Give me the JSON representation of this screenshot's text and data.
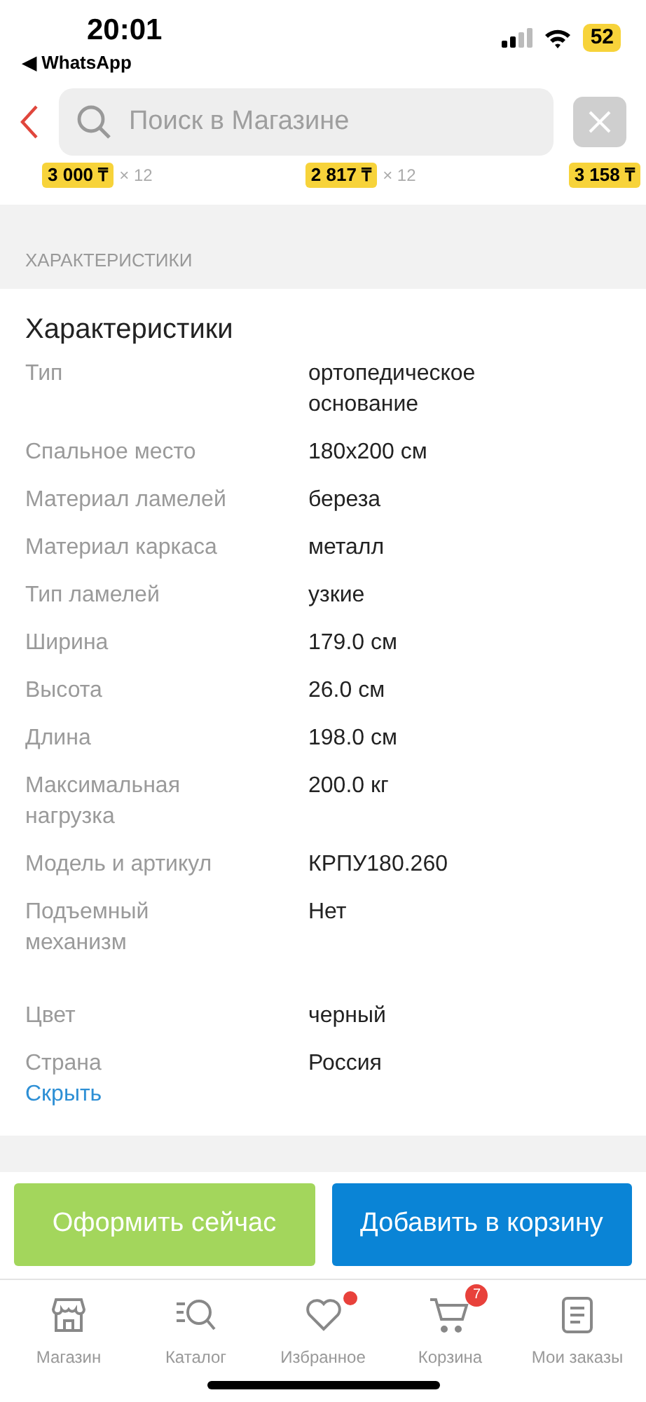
{
  "status_bar": {
    "time": "20:01",
    "back_app": "◀ WhatsApp",
    "battery": "52"
  },
  "header": {
    "search": {
      "placeholder": "Поиск в Магазине"
    }
  },
  "prices": [
    {
      "price": "3 000 ₸",
      "multiplier": "× 12"
    },
    {
      "price": "2 817 ₸",
      "multiplier": "× 12"
    },
    {
      "price": "3 158 ₸"
    }
  ],
  "section_heading": "ХАРАКТЕРИСТИКИ",
  "specs": {
    "title": "Характеристики",
    "rows": [
      {
        "label": "Тип",
        "value": "ортопедическое основание"
      },
      {
        "label": "Спальное место",
        "value": "180x200 см"
      },
      {
        "label": "Материал ламелей",
        "value": "береза"
      },
      {
        "label": "Материал каркаса",
        "value": "металл"
      },
      {
        "label": "Тип ламелей",
        "value": "узкие"
      },
      {
        "label": "Ширина",
        "value": "179.0 см"
      },
      {
        "label": "Высота",
        "value": "26.0 см"
      },
      {
        "label": "Длина",
        "value": "198.0 см"
      },
      {
        "label": "Максимальная нагрузка",
        "value": "200.0 кг"
      },
      {
        "label": "Модель и артикул",
        "value": "КРПУ180.260"
      },
      {
        "label": "Подъемный механизм",
        "value": "Нет"
      },
      {
        "label": "Цвет",
        "value": "черный",
        "gap_before": true
      },
      {
        "label": "Страна",
        "value": "Россия"
      }
    ],
    "hide_link": "Скрыть"
  },
  "actions": [
    {
      "label": "Оформить сейчас",
      "kind": "secondary"
    },
    {
      "label": "Добавить в корзину",
      "kind": "primary"
    }
  ],
  "nav": [
    {
      "label": "Магазин",
      "kind": "store"
    },
    {
      "label": "Каталог",
      "kind": "catalog"
    },
    {
      "label": "Избранное",
      "kind": "heart",
      "dot": true
    },
    {
      "label": "Корзина",
      "kind": "cart",
      "badge": "7"
    },
    {
      "label": "Мои заказы",
      "kind": "orders"
    }
  ]
}
